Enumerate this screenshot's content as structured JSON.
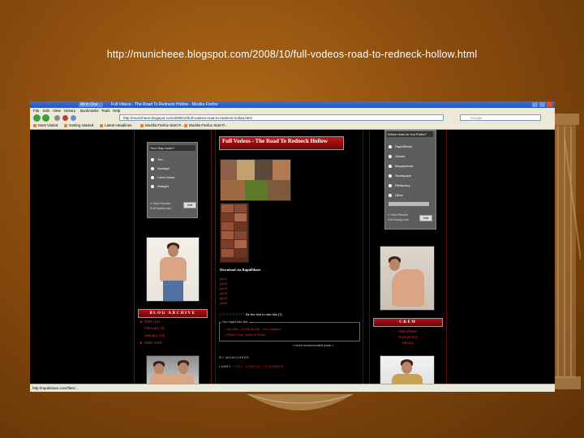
{
  "slide": {
    "caption": "http://municheee.blogspot.com/2008/10/full-vodeos-road-to-redneck-hollow.html"
  },
  "browser": {
    "window_title": "Full Videos · The Road To Redneck Hollow · Mozilla Firefox",
    "taskbar_tabs": [
      "All in One",
      "Full Videos"
    ],
    "menu": [
      "File",
      "Edit",
      "View",
      "History",
      "Bookmarks",
      "Tools",
      "Help"
    ],
    "url": "http://municheee.blogspot.com/2008/10/full-vodeos-road-to-redneck-hollow.html",
    "search_placeholder": "Google",
    "bookmarks": [
      "Most Visited",
      "Getting Started",
      "Latest Headlines",
      "Mozilla Firefox Start P...",
      "Mozilla Firefox Start P..."
    ],
    "status": "http://rapidshare.com/files/..."
  },
  "left_sidebar": {
    "poll": {
      "title": "Your Gay Lover?",
      "options": [
        "Yes",
        "Average",
        "I don't know",
        "Straight"
      ],
      "footer_lines": [
        "» View Results",
        "Poll Daddy.com"
      ],
      "vote_label": "Vote"
    },
    "archive": {
      "heading": "BLOG ARCHIVE",
      "items": [
        "► 2009 (15)",
        "February (3)",
        "January (12)",
        "► 2008 (100)"
      ]
    }
  },
  "post": {
    "title": "Full Vodeos - The Road To Redneck Hollow",
    "download_heading": "Download via RapidShare",
    "parts": [
      "part1",
      "part2",
      "part3",
      "part4",
      "part5",
      "part6"
    ],
    "rating_stars": "☆☆☆☆☆☆☆☆",
    "rating_text": "Be the first to rate this [?]",
    "related": {
      "legend": "You might also like",
      "items": [
        "• Jax Max · of the Month · Leo Giamani",
        "• Petra Cody · Brick & Stone"
      ],
      "more": "» more recommended posts »"
    },
    "byline": "BY MUNICHEEE",
    "labels_prefix": "LABEL:",
    "labels": "FULL VIDEOS, TITANMEN"
  },
  "right_sidebar": {
    "list": {
      "title": "Which Host do You Prefer?",
      "options": [
        "RapidShare",
        "Zshare",
        "Megaupload",
        "Sendspace",
        "Filefactory",
        "Other"
      ],
      "footer_lines": [
        "» View Results",
        "Poll Daddy.com"
      ],
      "vote_label": "Vote"
    },
    "crew": {
      "heading": "CREW",
      "items": [
        "Municheee",
        "Anonymous",
        "Moony"
      ]
    }
  }
}
